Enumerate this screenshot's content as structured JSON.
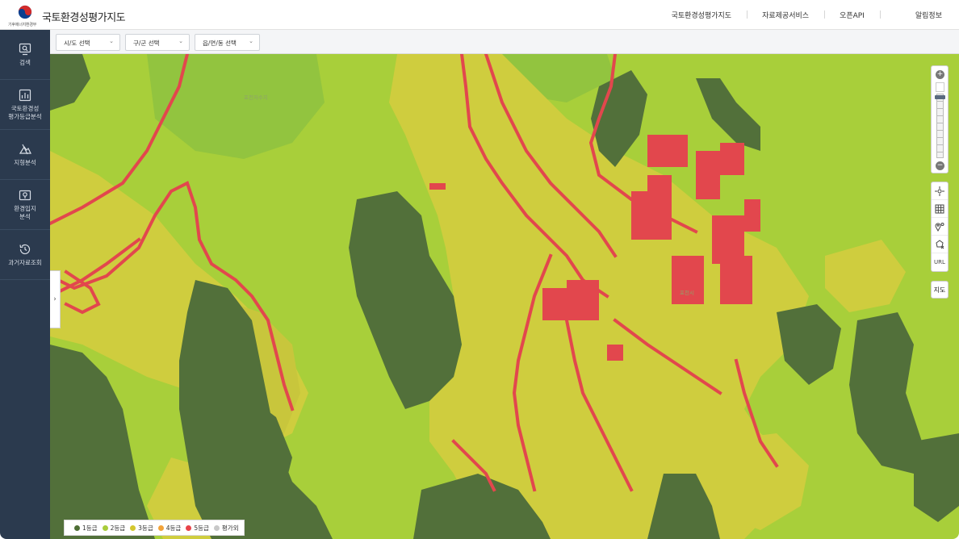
{
  "header": {
    "ministry": "기후에너지환경부",
    "app_title": "국토환경성평가지도",
    "nav": [
      "국토환경성평가지도",
      "자료제공서비스",
      "오픈API",
      "알림정보"
    ]
  },
  "sidebar": {
    "items": [
      {
        "label": "검색",
        "icon": "monitor-search-icon"
      },
      {
        "label": "국토환경성\n평가등급분석",
        "icon": "bar-chart-icon"
      },
      {
        "label": "지형분석",
        "icon": "terrain-icon"
      },
      {
        "label": "환경입지\n분석",
        "icon": "map-pin-icon"
      },
      {
        "label": "과거자료조회",
        "icon": "history-icon"
      }
    ]
  },
  "filters": {
    "sido": "시/도 선택",
    "gugun": "구/군 선택",
    "dong": "읍/면/동 선택"
  },
  "map": {
    "collapse": "›",
    "maptype": "지도",
    "url_tool": "URL"
  },
  "legend": {
    "items": [
      {
        "label": "1등급",
        "color": "#4e6e35"
      },
      {
        "label": "2등급",
        "color": "#a9cc3b"
      },
      {
        "label": "3등급",
        "color": "#d4c72e"
      },
      {
        "label": "4등급",
        "color": "#f2a33a"
      },
      {
        "label": "5등급",
        "color": "#e8434a"
      },
      {
        "label": "평가외",
        "color": "#c8c8c8"
      }
    ]
  },
  "colors": {
    "grade1": "#52703a",
    "grade2": "#a8cf3a",
    "grade2b": "#8fc23e",
    "grade3": "#cfcd3e",
    "grade5": "#e2474d",
    "sidebar": "#2b3a4e"
  }
}
